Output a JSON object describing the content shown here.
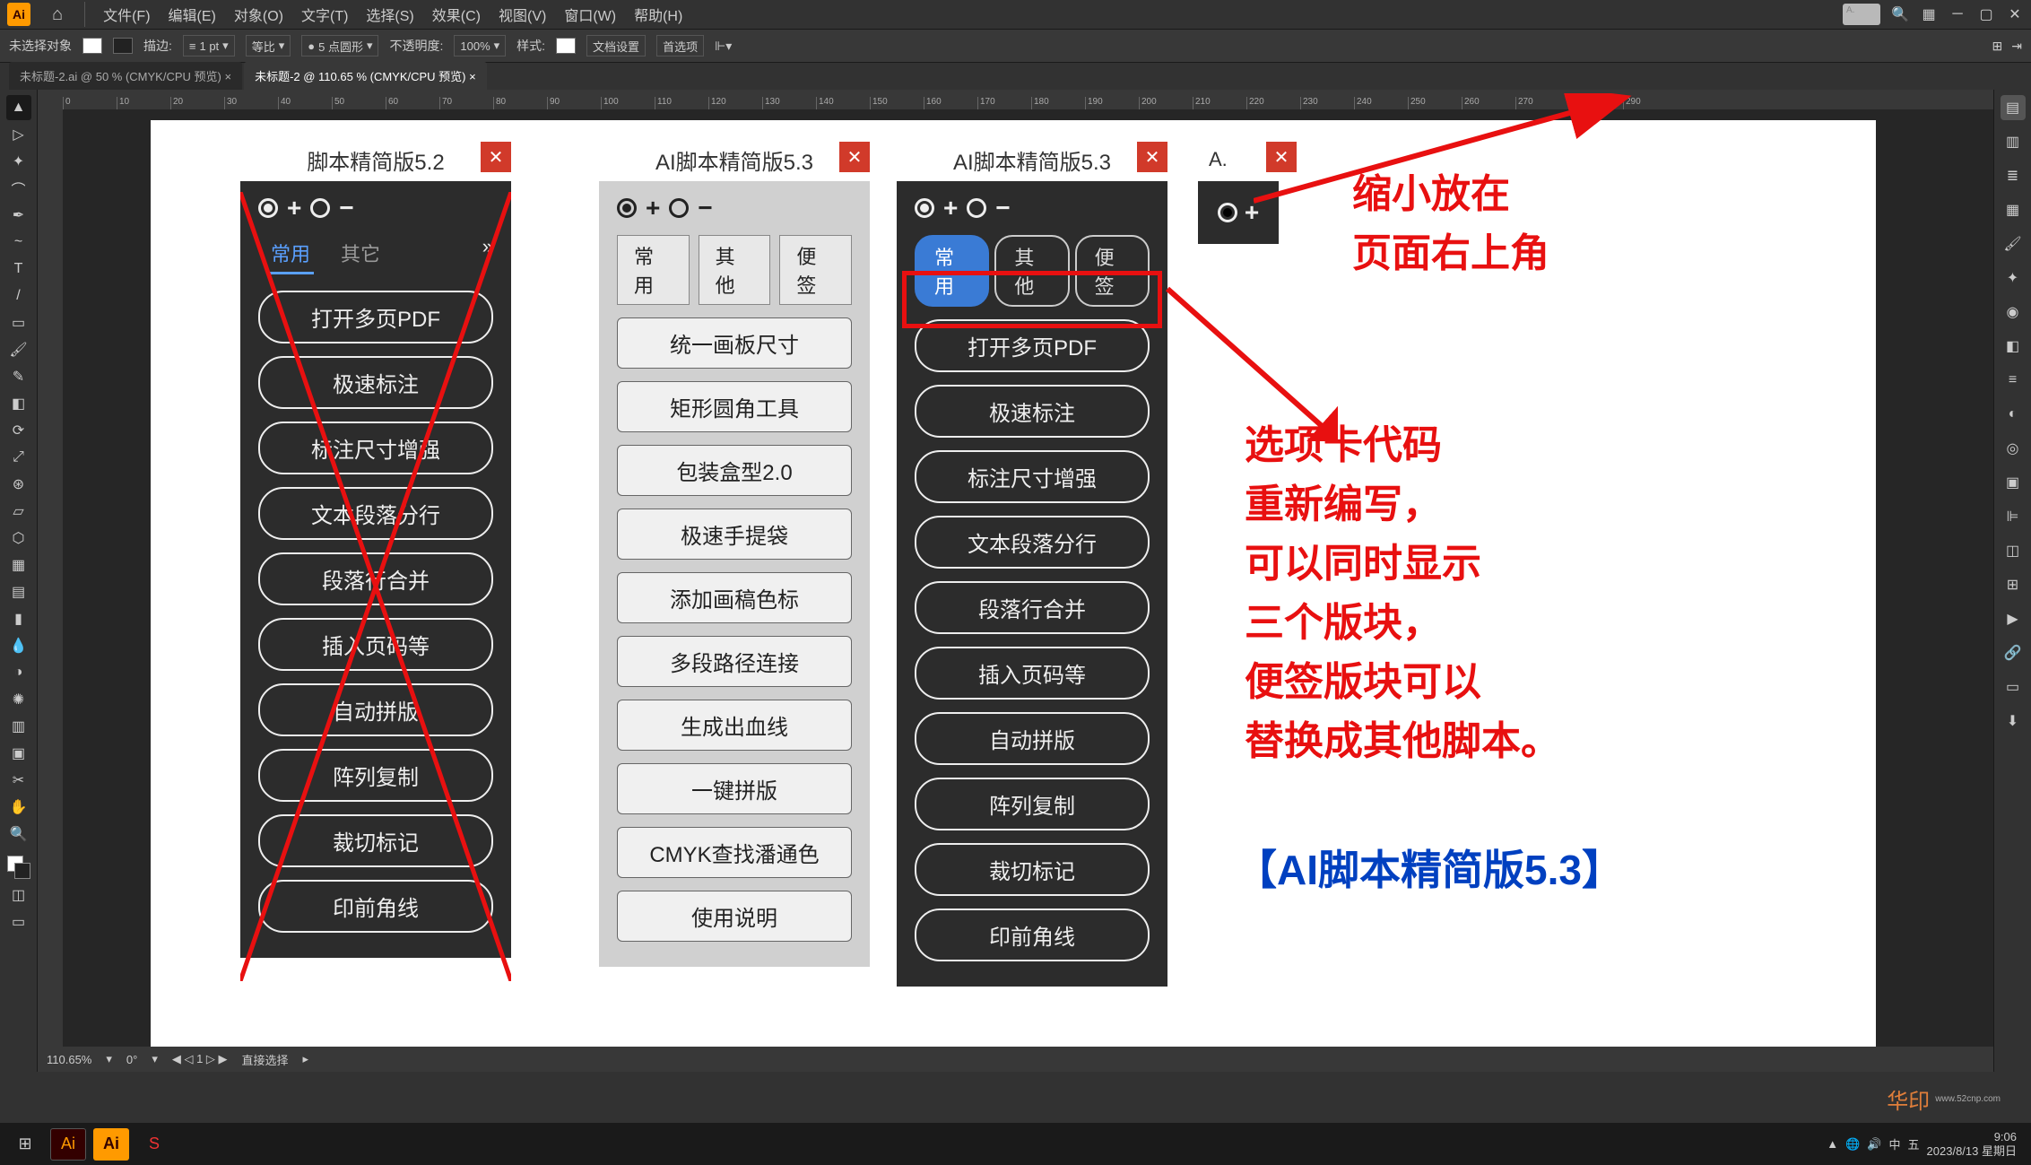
{
  "menubar": {
    "items": [
      "文件(F)",
      "编辑(E)",
      "对象(O)",
      "文字(T)",
      "选择(S)",
      "效果(C)",
      "视图(V)",
      "窗口(W)",
      "帮助(H)"
    ]
  },
  "optbar": {
    "noSelection": "未选择对象",
    "stroke": "描边:",
    "strokeVal": "1 pt",
    "uniform": "等比",
    "brush": "5 点圆形",
    "opacity": "不透明度:",
    "opacityVal": "100%",
    "style": "样式:",
    "docSetup": "文档设置",
    "prefs": "首选项"
  },
  "tabs": {
    "t1": "未标题-2.ai @ 50 % (CMYK/CPU 预览)",
    "t2": "未标题-2 @ 110.65 % (CMYK/CPU 预览)"
  },
  "panel52": {
    "title": "脚本精简版5.2",
    "tabs": [
      "常用",
      "其它"
    ],
    "buttons": [
      "打开多页PDF",
      "极速标注",
      "标注尺寸增强",
      "文本段落分行",
      "段落行合并",
      "插入页码等",
      "自动拼版",
      "阵列复制",
      "裁切标记",
      "印前角线"
    ]
  },
  "panel53light": {
    "title": "AI脚本精简版5.3",
    "tabs": [
      "常用",
      "其他",
      "便签"
    ],
    "buttons": [
      "统一画板尺寸",
      "矩形圆角工具",
      "包装盒型2.0",
      "极速手提袋",
      "添加画稿色标",
      "多段路径连接",
      "生成出血线",
      "一键拼版",
      "CMYK查找潘通色",
      "使用说明"
    ]
  },
  "panel53dark": {
    "title": "AI脚本精简版5.3",
    "tabs": [
      "常用",
      "其他",
      "便签"
    ],
    "buttons": [
      "打开多页PDF",
      "极速标注",
      "标注尺寸增强",
      "文本段落分行",
      "段落行合并",
      "插入页码等",
      "自动拼版",
      "阵列复制",
      "裁切标记",
      "印前角线"
    ]
  },
  "panelA": {
    "title": "A."
  },
  "anno": {
    "topRight": "缩小放在\n页面右上角",
    "body": "选项卡代码\n重新编写，\n可以同时显示\n三个版块，\n便签版块可以\n替换成其他脚本。",
    "productName": "【AI脚本精简版5.3】"
  },
  "status": {
    "zoom": "110.65%",
    "angle": "0°",
    "artboard": "1",
    "tool": "直接选择"
  },
  "topSearch": "A.",
  "taskbar": {
    "time": "9:06",
    "date": "2023/8/13 星期日"
  },
  "watermark": {
    "text": "华印",
    "url": "www.52cnp.com"
  }
}
